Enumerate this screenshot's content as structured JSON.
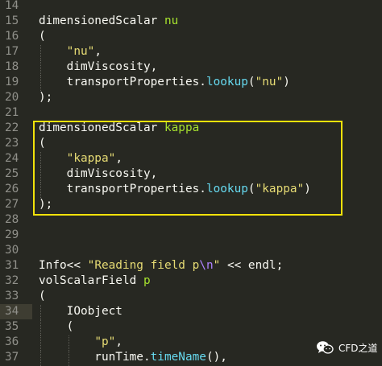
{
  "editor": {
    "lines": [
      {
        "num": "14",
        "tokens": []
      },
      {
        "num": "15",
        "tokens": [
          {
            "t": "dimensionedScalar ",
            "c": "plain"
          },
          {
            "t": "nu",
            "c": "type"
          }
        ]
      },
      {
        "num": "16",
        "tokens": [
          {
            "t": "(",
            "c": "plain"
          }
        ]
      },
      {
        "num": "17",
        "tokens": [
          {
            "t": "    ",
            "c": "plain"
          },
          {
            "t": "\"nu\"",
            "c": "str"
          },
          {
            "t": ",",
            "c": "plain"
          }
        ]
      },
      {
        "num": "18",
        "tokens": [
          {
            "t": "    dimViscosity,",
            "c": "plain"
          }
        ]
      },
      {
        "num": "19",
        "tokens": [
          {
            "t": "    transportProperties.",
            "c": "plain"
          },
          {
            "t": "lookup",
            "c": "func"
          },
          {
            "t": "(",
            "c": "plain"
          },
          {
            "t": "\"nu\"",
            "c": "str"
          },
          {
            "t": ")",
            "c": "plain"
          }
        ]
      },
      {
        "num": "20",
        "tokens": [
          {
            "t": ");",
            "c": "plain"
          }
        ]
      },
      {
        "num": "21",
        "tokens": []
      },
      {
        "num": "22",
        "tokens": [
          {
            "t": "dimensionedScalar ",
            "c": "plain"
          },
          {
            "t": "kappa",
            "c": "type"
          }
        ]
      },
      {
        "num": "23",
        "tokens": [
          {
            "t": "(",
            "c": "plain"
          }
        ]
      },
      {
        "num": "24",
        "tokens": [
          {
            "t": "    ",
            "c": "plain"
          },
          {
            "t": "\"kappa\"",
            "c": "str"
          },
          {
            "t": ",",
            "c": "plain"
          }
        ]
      },
      {
        "num": "25",
        "tokens": [
          {
            "t": "    dimViscosity,",
            "c": "plain"
          }
        ]
      },
      {
        "num": "26",
        "tokens": [
          {
            "t": "    transportProperties.",
            "c": "plain"
          },
          {
            "t": "lookup",
            "c": "func"
          },
          {
            "t": "(",
            "c": "plain"
          },
          {
            "t": "\"kappa\"",
            "c": "str"
          },
          {
            "t": ")",
            "c": "plain"
          }
        ]
      },
      {
        "num": "27",
        "tokens": [
          {
            "t": ");",
            "c": "plain"
          }
        ]
      },
      {
        "num": "28",
        "tokens": []
      },
      {
        "num": "29",
        "tokens": []
      },
      {
        "num": "30",
        "tokens": []
      },
      {
        "num": "31",
        "tokens": [
          {
            "t": "Info<< ",
            "c": "plain"
          },
          {
            "t": "\"Reading field p",
            "c": "str"
          },
          {
            "t": "\\n",
            "c": "esc"
          },
          {
            "t": "\"",
            "c": "str"
          },
          {
            "t": " << endl;",
            "c": "plain"
          }
        ]
      },
      {
        "num": "32",
        "tokens": [
          {
            "t": "volScalarField ",
            "c": "plain"
          },
          {
            "t": "p",
            "c": "type"
          }
        ]
      },
      {
        "num": "33",
        "tokens": [
          {
            "t": "(",
            "c": "plain"
          }
        ]
      },
      {
        "num": "34",
        "tokens": [
          {
            "t": "    IOobject",
            "c": "plain"
          }
        ]
      },
      {
        "num": "35",
        "tokens": [
          {
            "t": "    (",
            "c": "plain"
          }
        ]
      },
      {
        "num": "36",
        "tokens": [
          {
            "t": "        ",
            "c": "plain"
          },
          {
            "t": "\"p\"",
            "c": "str"
          },
          {
            "t": ",",
            "c": "plain"
          }
        ]
      },
      {
        "num": "37",
        "tokens": [
          {
            "t": "        runTime.",
            "c": "plain"
          },
          {
            "t": "timeName",
            "c": "func"
          },
          {
            "t": "(),",
            "c": "plain"
          }
        ]
      }
    ],
    "current_line": "34",
    "colors": {
      "background": "#272822",
      "highlight_box": "#f2e20a",
      "string": "#e6db74",
      "type_name": "#a6e22e",
      "function": "#66d9ef",
      "escape": "#ae81ff"
    }
  },
  "watermark": {
    "text": "CFD之道",
    "icon": "wechat-icon"
  }
}
